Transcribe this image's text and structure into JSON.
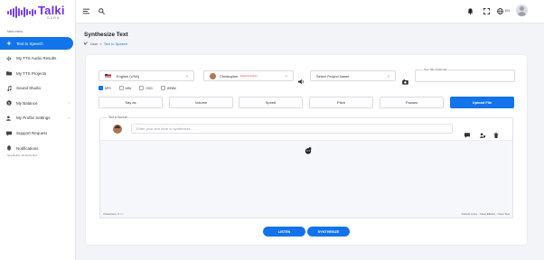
{
  "app": {
    "name": "Talki",
    "subtitle": "GURU"
  },
  "sidebar": {
    "section_title": "Main menu",
    "items": [
      {
        "label": "Text to Speech",
        "icon": "sparkle-icon",
        "active": true
      },
      {
        "label": "My TTS Audio Results",
        "icon": "waveform-icon"
      },
      {
        "label": "My TTS Projects",
        "icon": "folder-icon"
      },
      {
        "label": "Sound Studio",
        "icon": "music-icon"
      },
      {
        "label": "My Balance",
        "icon": "wallet-icon",
        "has_caret": true
      },
      {
        "label": "My Profile Settings",
        "icon": "user-gear-icon",
        "has_caret": true
      },
      {
        "label": "Support Request",
        "icon": "support-icon"
      },
      {
        "label": "Notifications",
        "icon": "bell-icon"
      }
    ],
    "see_more": "See Below, All Items Ref."
  },
  "topbar": {
    "language_code": "EN"
  },
  "page": {
    "title": "Synthesize Text",
    "breadcrumb": {
      "root": "User",
      "current": "Text to Speech"
    }
  },
  "form": {
    "language": "English (USA)",
    "voice": "Christopher",
    "voice_badge": "(Neural Voice)",
    "project_placeholder": "Select Project Name",
    "title_legend": "Text Title (Optional)",
    "formats": [
      {
        "label": "MP3",
        "selected": true
      },
      {
        "label": "WAV",
        "selected": false
      },
      {
        "label": "OGG",
        "selected": false
      },
      {
        "label": "WEBM",
        "selected": false
      }
    ],
    "controls": [
      "Say as",
      "Volume",
      "Speed",
      "Pitch",
      "Pauses"
    ],
    "upload_label": "Upload File",
    "speech_legend": "Text to Speech",
    "text_placeholder": "Enter your text here to synthesize...",
    "char_count": "Characters: 0 / ∞",
    "defaults_text": "Default Lines · Clear Effects · Clear Text"
  },
  "actions": {
    "listen": "LISTEN",
    "synthesize": "SYNTHESIZE"
  },
  "colors": {
    "accent": "#1273eb",
    "brand": "#6b2fe8"
  }
}
